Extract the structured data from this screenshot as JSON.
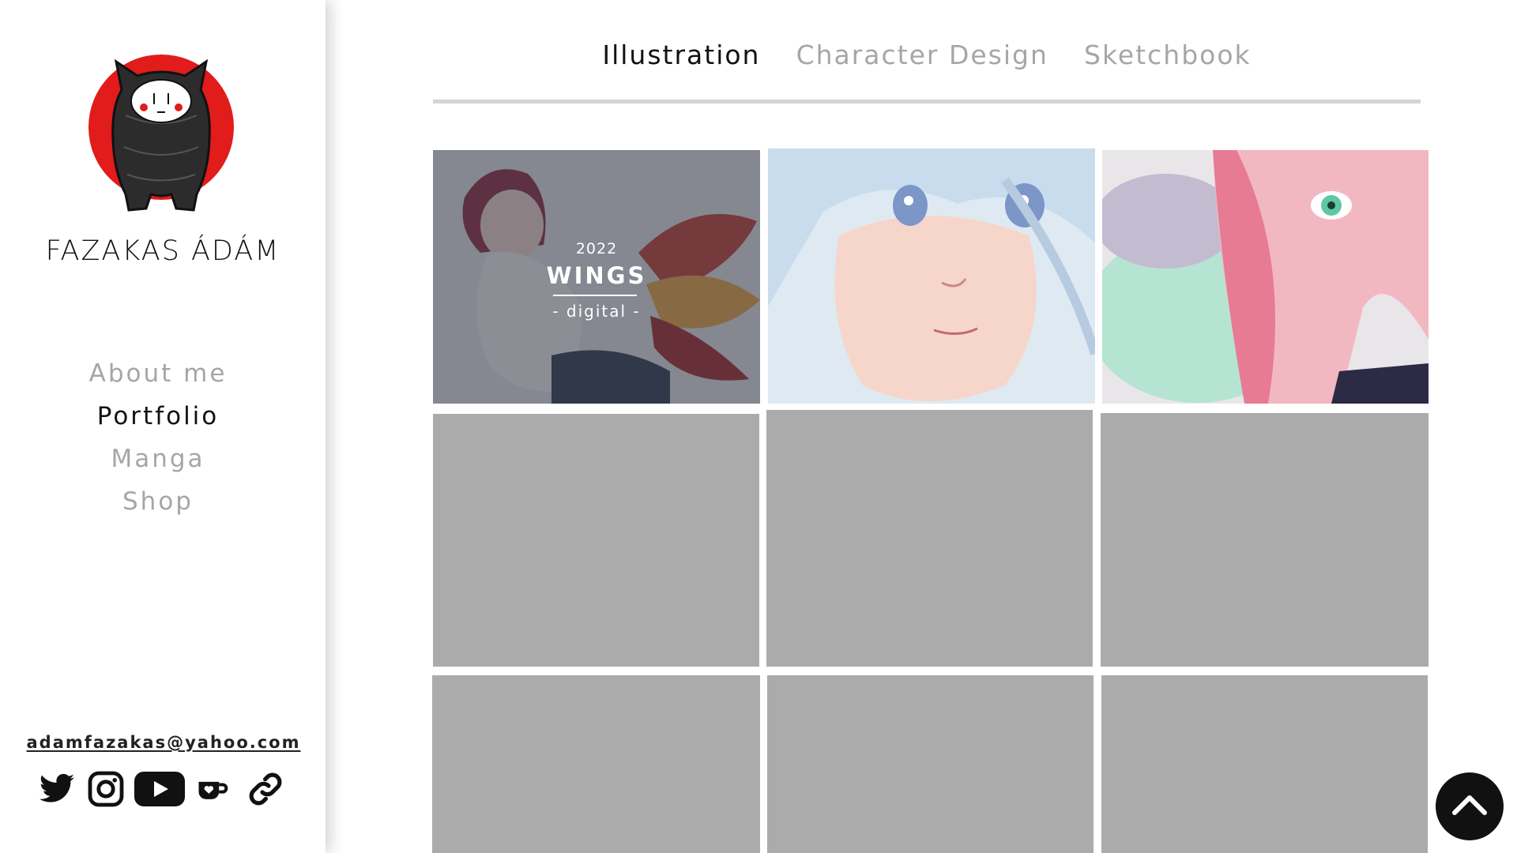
{
  "site": {
    "name": "FAZAKAS ÁDÁM"
  },
  "nav": {
    "items": [
      "About me",
      "Portfolio",
      "Manga",
      "Shop"
    ],
    "active_index": 1
  },
  "contact": {
    "email": "adamfazakas@yahoo.com"
  },
  "socials": [
    "twitter-icon",
    "instagram-icon",
    "youtube-icon",
    "kofi-icon",
    "link-icon"
  ],
  "tabs": {
    "items": [
      "Illustration",
      "Character Design",
      "Sketchbook"
    ],
    "active_index": 0
  },
  "gallery": {
    "featured": {
      "year": "2022",
      "title": "WINGS",
      "medium": "- digital -"
    }
  },
  "colors": {
    "accent_red": "#e21b1b",
    "placeholder_gray": "#ababab",
    "text_dark": "#111111",
    "text_muted": "#a6a6a6"
  },
  "back_to_top_icon": "chevron-up-icon"
}
